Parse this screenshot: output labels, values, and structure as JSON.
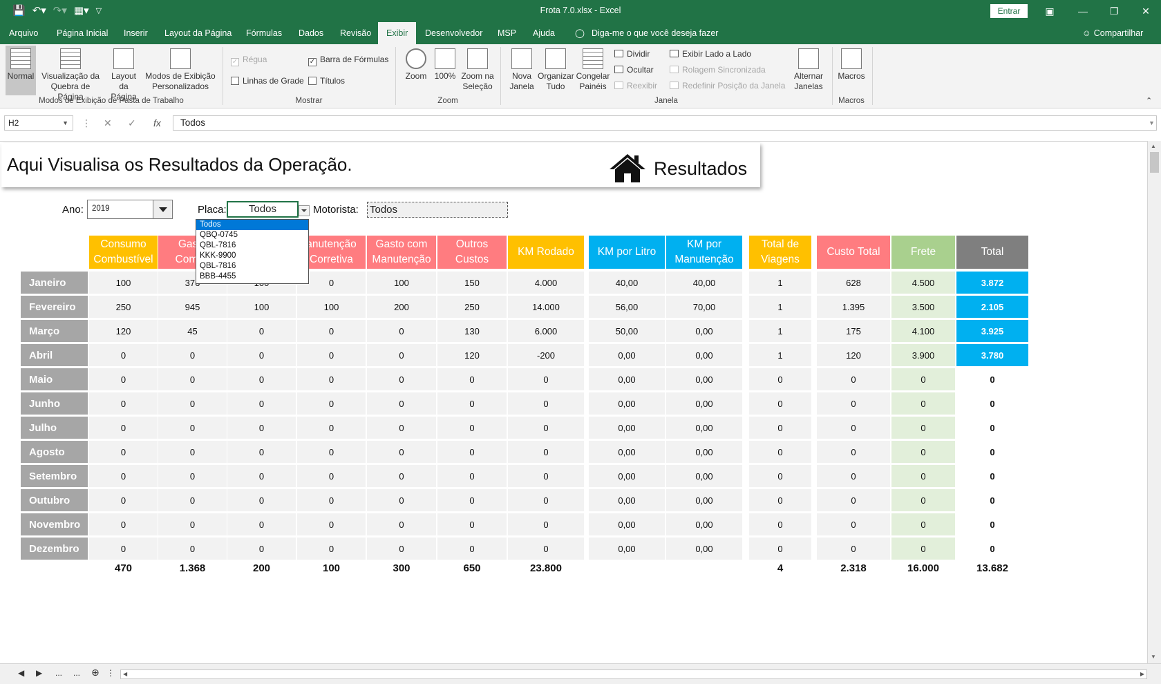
{
  "window": {
    "title": "Frota 7.0.xlsx  -  Excel",
    "signin_label": "Entrar"
  },
  "menu": {
    "tabs": [
      "Arquivo",
      "Página Inicial",
      "Inserir",
      "Layout da Página",
      "Fórmulas",
      "Dados",
      "Revisão",
      "Exibir",
      "Desenvolvedor",
      "MSP",
      "Ajuda"
    ],
    "active_tab": "Exibir",
    "tell_me": "Diga-me o que você deseja fazer",
    "share": "Compartilhar"
  },
  "ribbon": {
    "views": {
      "normal": "Normal",
      "page_break_1": "Visualização da",
      "page_break_2": "Quebra de Página",
      "page_layout_1": "Layout",
      "page_layout_2": "da Página",
      "custom_views_1": "Modos de Exibição",
      "custom_views_2": "Personalizados",
      "group": "Modos de Exibição de Pasta de Trabalho"
    },
    "show": {
      "ruler": "Régua",
      "formula_bar": "Barra de Fórmulas",
      "gridlines": "Linhas de Grade",
      "headings": "Títulos",
      "group": "Mostrar"
    },
    "zoom": {
      "zoom": "Zoom",
      "hundred": "100%",
      "selection_1": "Zoom na",
      "selection_2": "Seleção",
      "group": "Zoom"
    },
    "window": {
      "new_1": "Nova",
      "new_2": "Janela",
      "arrange_1": "Organizar",
      "arrange_2": "Tudo",
      "freeze_1": "Congelar",
      "freeze_2": "Painéis",
      "split": "Dividir",
      "hide": "Ocultar",
      "unhide": "Reexibir",
      "side_by_side": "Exibir Lado a Lado",
      "sync_scroll": "Rolagem Sincronizada",
      "reset_pos": "Redefinir Posição da Janela",
      "switch_1": "Alternar",
      "switch_2": "Janelas",
      "group": "Janela"
    },
    "macros": {
      "macros": "Macros",
      "group": "Macros"
    }
  },
  "formula_bar": {
    "name_box": "H2",
    "fx": "fx",
    "value": "Todos"
  },
  "sheet": {
    "headline": "Aqui Visualisa os Resultados da Operação.",
    "results_title": "Resultados",
    "filters": {
      "ano_label": "Ano:",
      "ano_value": "2019",
      "placa_label": "Placa:",
      "placa_value": "Todos",
      "motorista_label": "Motorista:",
      "motorista_value": "Todos"
    },
    "placa_options": [
      "Todos",
      "QBQ-0745",
      "QBL-7816",
      "KKK-9900",
      "QBL-7816",
      "BBB-4455"
    ],
    "columns": [
      {
        "l1": "Consumo",
        "l2": "Combustível",
        "color": "#ffc000"
      },
      {
        "l1": "Gasto",
        "l2": "Combu",
        "color": "#ff7c80"
      },
      {
        "l1": "",
        "l2": "",
        "color": "#ff7c80"
      },
      {
        "l1": "anutenção",
        "l2": "Corretiva",
        "color": "#ff7c80"
      },
      {
        "l1": "Gasto com",
        "l2": "Manutenção",
        "color": "#ff7c80"
      },
      {
        "l1": "Outros",
        "l2": "Custos",
        "color": "#ff7c80"
      },
      {
        "l1": "KM Rodado",
        "l2": "",
        "color": "#ffc000"
      },
      {
        "l1": "KM por Litro",
        "l2": "",
        "color": "#00b0f0"
      },
      {
        "l1": "KM por",
        "l2": "Manutenção",
        "color": "#00b0f0"
      },
      {
        "l1": "Total de",
        "l2": "Viagens",
        "color": "#ffc000"
      },
      {
        "l1": "Custo Total",
        "l2": "",
        "color": "#ff7c80"
      },
      {
        "l1": "Frete",
        "l2": "",
        "color": "#a9d08e"
      },
      {
        "l1": "Total",
        "l2": "",
        "color": "#7f7f7f"
      }
    ],
    "months": [
      "Janeiro",
      "Fevereiro",
      "Março",
      "Abril",
      "Maio",
      "Junho",
      "Julho",
      "Agosto",
      "Setembro",
      "Outubro",
      "Novembro",
      "Dezembro"
    ],
    "rows": [
      [
        "100",
        "376",
        "100",
        "0",
        "100",
        "150",
        "4.000",
        "40,00",
        "40,00",
        "1",
        "628",
        "4.500",
        "3.872"
      ],
      [
        "250",
        "945",
        "100",
        "100",
        "200",
        "250",
        "14.000",
        "56,00",
        "70,00",
        "1",
        "1.395",
        "3.500",
        "2.105"
      ],
      [
        "120",
        "45",
        "0",
        "0",
        "0",
        "130",
        "6.000",
        "50,00",
        "0,00",
        "1",
        "175",
        "4.100",
        "3.925"
      ],
      [
        "0",
        "0",
        "0",
        "0",
        "0",
        "120",
        "-200",
        "0,00",
        "0,00",
        "1",
        "120",
        "3.900",
        "3.780"
      ],
      [
        "0",
        "0",
        "0",
        "0",
        "0",
        "0",
        "0",
        "0,00",
        "0,00",
        "0",
        "0",
        "0",
        "0"
      ],
      [
        "0",
        "0",
        "0",
        "0",
        "0",
        "0",
        "0",
        "0,00",
        "0,00",
        "0",
        "0",
        "0",
        "0"
      ],
      [
        "0",
        "0",
        "0",
        "0",
        "0",
        "0",
        "0",
        "0,00",
        "0,00",
        "0",
        "0",
        "0",
        "0"
      ],
      [
        "0",
        "0",
        "0",
        "0",
        "0",
        "0",
        "0",
        "0,00",
        "0,00",
        "0",
        "0",
        "0",
        "0"
      ],
      [
        "0",
        "0",
        "0",
        "0",
        "0",
        "0",
        "0",
        "0,00",
        "0,00",
        "0",
        "0",
        "0",
        "0"
      ],
      [
        "0",
        "0",
        "0",
        "0",
        "0",
        "0",
        "0",
        "0,00",
        "0,00",
        "0",
        "0",
        "0",
        "0"
      ],
      [
        "0",
        "0",
        "0",
        "0",
        "0",
        "0",
        "0",
        "0,00",
        "0,00",
        "0",
        "0",
        "0",
        "0"
      ],
      [
        "0",
        "0",
        "0",
        "0",
        "0",
        "0",
        "0",
        "0,00",
        "0,00",
        "0",
        "0",
        "0",
        "0"
      ]
    ],
    "totals": [
      "470",
      "1.368",
      "200",
      "100",
      "300",
      "650",
      "23.800",
      "",
      "",
      "4",
      "2.318",
      "16.000",
      "13.682"
    ],
    "highlight_total_color": "#00b0f0",
    "frete_cell_color": "#e2efda",
    "month_cell_color": "#a6a6a6",
    "data_cell_color": "#f2f2f2"
  },
  "bottom": {
    "ellipsis": "..."
  }
}
